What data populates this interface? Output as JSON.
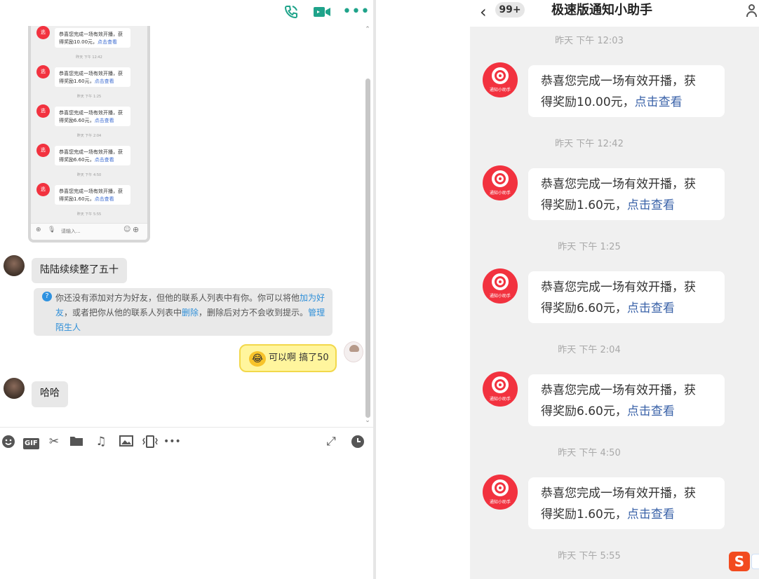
{
  "left_chat": {
    "top_actions": [
      "phone-icon",
      "video-call-icon",
      "more-icon"
    ],
    "mini": {
      "items": [
        {
          "line1": "恭喜您完成一场有效开播，获",
          "line2a": "得奖励10.00元，",
          "link": "点击查看",
          "time": "昨天 下午 12:42"
        },
        {
          "line1": "恭喜您完成一场有效开播，获",
          "line2a": "得奖励1.60元，",
          "link": "点击查看",
          "time": "昨天 下午 1:25"
        },
        {
          "line1": "恭喜您完成一场有效开播，获",
          "line2a": "得奖励6.60元，",
          "link": "点击查看",
          "time": "昨天 下午 2:04"
        },
        {
          "line1": "恭喜您完成一场有效开播，获",
          "line2a": "得奖励6.60元，",
          "link": "点击查看",
          "time": "昨天 下午 4:50"
        },
        {
          "line1": "恭喜您完成一场有效开播，获",
          "line2a": "得奖励1.60元，",
          "link": "点击查看",
          "time": "昨天 下午 5:55"
        }
      ],
      "avatar_text": "逃",
      "input_placeholder": "请输入..."
    },
    "message1": "陆陆续续整了五十",
    "notice": {
      "part1": "你还没有添加对方为好友，但他的联系人列表中有你。你可以将他",
      "link1": "加为好友",
      "part2": "，或者把你从他的联系人列表中",
      "link2": "删除",
      "part3": "，删除后对方不会收到提示。",
      "link3": "管理陌生人"
    },
    "my_message": "可以啊 搞了50",
    "message2": "哈哈",
    "toolbar": [
      "emoji-icon",
      "gif-icon",
      "scissors-icon",
      "folder-icon",
      "music-icon",
      "image-icon",
      "shake-icon",
      "more-icon",
      "expand-icon",
      "history-icon"
    ],
    "gif_label": "GIF"
  },
  "phone": {
    "badge": "99+",
    "title": "极速版通知小助手",
    "avatar_caption": "通知小助手",
    "messages": [
      {
        "time": "昨天 下午 12:03",
        "line1": "恭喜您完成一场有效开播，获",
        "line2": "得奖励10.00元，",
        "link": "点击查看"
      },
      {
        "time": "昨天 下午 12:42",
        "line1": "恭喜您完成一场有效开播，获",
        "line2": "得奖励1.60元，",
        "link": "点击查看"
      },
      {
        "time": "昨天 下午 1:25",
        "line1": "恭喜您完成一场有效开播，获",
        "line2": "得奖励6.60元，",
        "link": "点击查看"
      },
      {
        "time": "昨天 下午 2:04",
        "line1": "恭喜您完成一场有效开播，获",
        "line2": "得奖励6.60元，",
        "link": "点击查看"
      },
      {
        "time": "昨天 下午 4:50",
        "line1": "恭喜您完成一场有效开播，获",
        "line2": "得奖励1.60元，",
        "link": "点击查看"
      }
    ],
    "last_time": "昨天 下午 5:55"
  },
  "colors": {
    "accent": "#1fa38a",
    "link": "#2f8fd8",
    "phone_link": "#3a62a8",
    "brand_red": "#f2323f",
    "sogou": "#f24b1f"
  }
}
